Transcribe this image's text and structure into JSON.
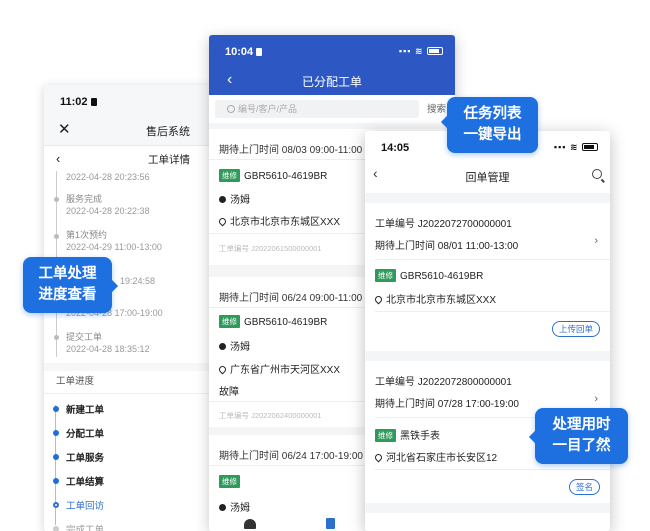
{
  "phone_detail": {
    "status_time": "11:02",
    "app_title": "售后系统",
    "page_title": "工单详情",
    "timeline": [
      {
        "label": "",
        "date": "2022-04-28 20:23:56"
      },
      {
        "label": "服务完成",
        "date": "2022-04-28 20:22:38"
      },
      {
        "label": "第1次预约",
        "date": "2022-04-29 11:00-13:00"
      },
      {
        "label": "",
        "date": "19:24:58"
      },
      {
        "label": "",
        "date": "2022-04-28 17:00-19:00"
      },
      {
        "label": "提交工单",
        "date": "2022-04-28 18:35:12"
      }
    ],
    "progress_title": "工单进度",
    "progress": [
      "新建工单",
      "分配工单",
      "工单服务",
      "工单结算",
      "工单回访",
      "完成工单"
    ]
  },
  "phone_assigned": {
    "status_time": "10:04",
    "title": "已分配工单",
    "search_placeholder": "编号/客户/产品",
    "search_button": "搜索",
    "cards": [
      {
        "appt": "期待上门时间 08/03 09:00-11:00",
        "tag": "维修",
        "plate": "GBR5610-4619BR",
        "person": "汤姆",
        "addr": "北京市北京市东城区XXX",
        "fault": "",
        "no": "工单编号 J2022061500000001"
      },
      {
        "appt": "期待上门时间 06/24 09:00-11:00",
        "tag": "维修",
        "plate": "GBR5610-4619BR",
        "person": "汤姆",
        "addr": "广东省广州市天河区XXX",
        "fault": "故障",
        "no": "工单编号 J2022062400000001"
      },
      {
        "appt": "期待上门时间 06/24 17:00-19:00",
        "tag": "维修",
        "plate": "",
        "person": "汤姆",
        "addr": "",
        "fault": "",
        "no": ""
      }
    ]
  },
  "phone_return": {
    "status_time": "14:05",
    "title": "回单管理",
    "cards": [
      {
        "no": "工单编号 J2022072700000001",
        "appt": "期待上门时间 08/01 11:00-13:00",
        "tag": "维修",
        "product": "GBR5610-4619BR",
        "addr": "北京市北京市东城区XXX",
        "button": "上传回单"
      },
      {
        "no": "工单编号 J2022072800000001",
        "appt": "期待上门时间 07/28 17:00-19:00",
        "tag": "维修",
        "product": "黑铁手表",
        "addr": "河北省石家庄市长安区12",
        "button": "签名"
      }
    ]
  },
  "callouts": {
    "progress": "工单处理\n进度查看",
    "export": "任务列表\n一键导出",
    "time": "处理用时\n一目了然"
  },
  "colors": {
    "primary": "#2d58c4",
    "accent": "#1e6fe0",
    "tag": "#2f9b5a"
  }
}
